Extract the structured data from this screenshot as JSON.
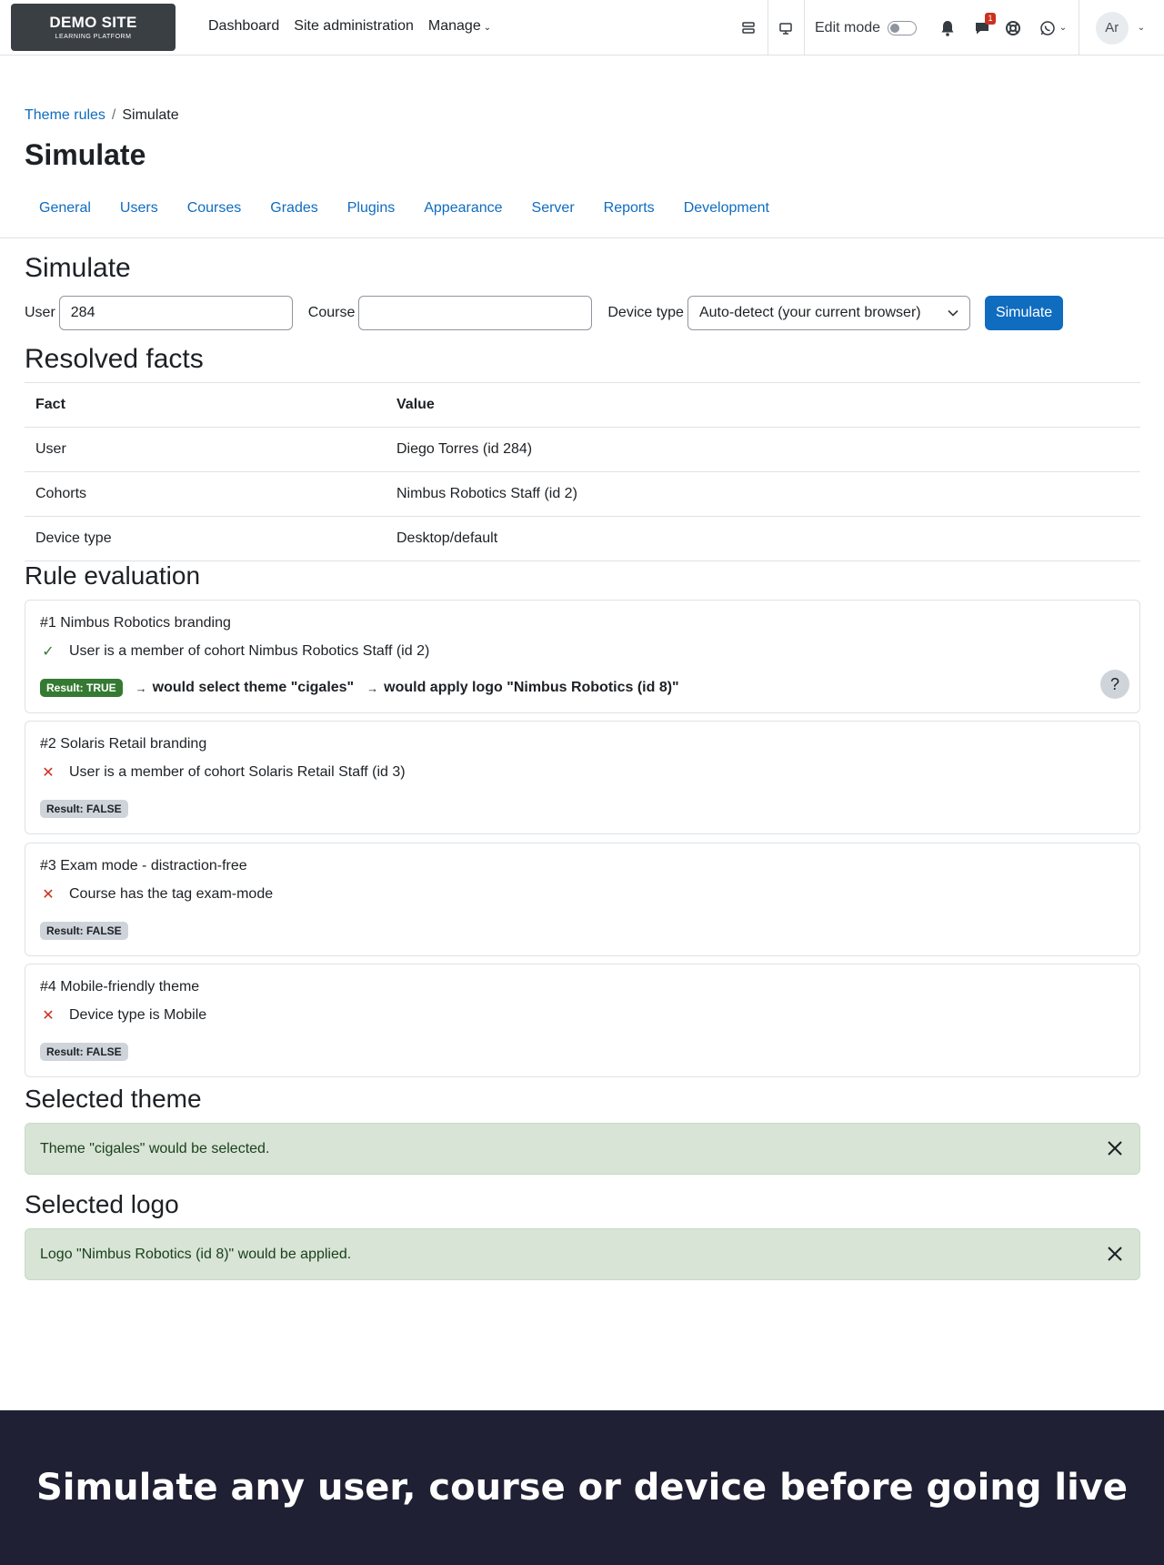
{
  "brand": {
    "name": "DEMO SITE",
    "tagline": "LEARNING PLATFORM"
  },
  "nav": {
    "items": [
      {
        "label": "Dashboard"
      },
      {
        "label": "Site administration"
      },
      {
        "label": "Manage"
      }
    ],
    "edit_mode_label": "Edit mode",
    "edit_mode_on": false,
    "messages_count": "1",
    "avatar_initials": "Ar"
  },
  "breadcrumb": [
    {
      "label": "Theme rules"
    },
    {
      "label": "Simulate"
    }
  ],
  "page_title": "Simulate",
  "tabs": [
    {
      "label": "General"
    },
    {
      "label": "Users"
    },
    {
      "label": "Courses"
    },
    {
      "label": "Grades"
    },
    {
      "label": "Plugins"
    },
    {
      "label": "Appearance"
    },
    {
      "label": "Server"
    },
    {
      "label": "Reports"
    },
    {
      "label": "Development"
    }
  ],
  "simulate": {
    "heading": "Simulate",
    "user_label": "User",
    "user_value": "284",
    "course_label": "Course",
    "course_value": "",
    "device_label": "Device type",
    "device_value": "Auto-detect (your current browser)",
    "submit_label": "Simulate"
  },
  "facts": {
    "heading": "Resolved facts",
    "columns": [
      "Fact",
      "Value"
    ],
    "rows": [
      {
        "fact": "User",
        "value": "Diego Torres (id 284)"
      },
      {
        "fact": "Cohorts",
        "value": "Nimbus Robotics Staff (id 2)"
      },
      {
        "fact": "Device type",
        "value": "Desktop/default"
      }
    ]
  },
  "evaluation": {
    "heading": "Rule evaluation",
    "rules": [
      {
        "title": "#1 Nimbus Robotics branding",
        "condition": "User is a member of cohort Nimbus Robotics Staff (id 2)",
        "matched": true,
        "result": "Result: TRUE",
        "theme_arrow": "→",
        "theme_text": "would select theme \"cigales\"",
        "logo_arrow": "→",
        "logo_text": "would apply logo \"Nimbus Robotics (id 8)\"",
        "help": "?"
      },
      {
        "title": "#2 Solaris Retail branding",
        "condition": "User is a member of cohort Solaris Retail Staff (id 3)",
        "matched": false,
        "result": "Result: FALSE"
      },
      {
        "title": "#3 Exam mode - distraction-free",
        "condition": "Course has the tag exam-mode",
        "matched": false,
        "result": "Result: FALSE"
      },
      {
        "title": "#4 Mobile-friendly theme",
        "condition": "Device type is Mobile",
        "matched": false,
        "result": "Result: FALSE"
      }
    ]
  },
  "selected_theme": {
    "heading": "Selected theme",
    "message": "Theme \"cigales\" would be selected."
  },
  "selected_logo": {
    "heading": "Selected logo",
    "message": "Logo \"Nimbus Robotics (id 8)\" would be applied."
  },
  "banner": {
    "text": "Simulate any user, course or device before going live"
  },
  "colors": {
    "primary": "#0f6cbf",
    "success": "#357a32",
    "danger": "#ca3120",
    "banner_bg": "#1f2033"
  }
}
